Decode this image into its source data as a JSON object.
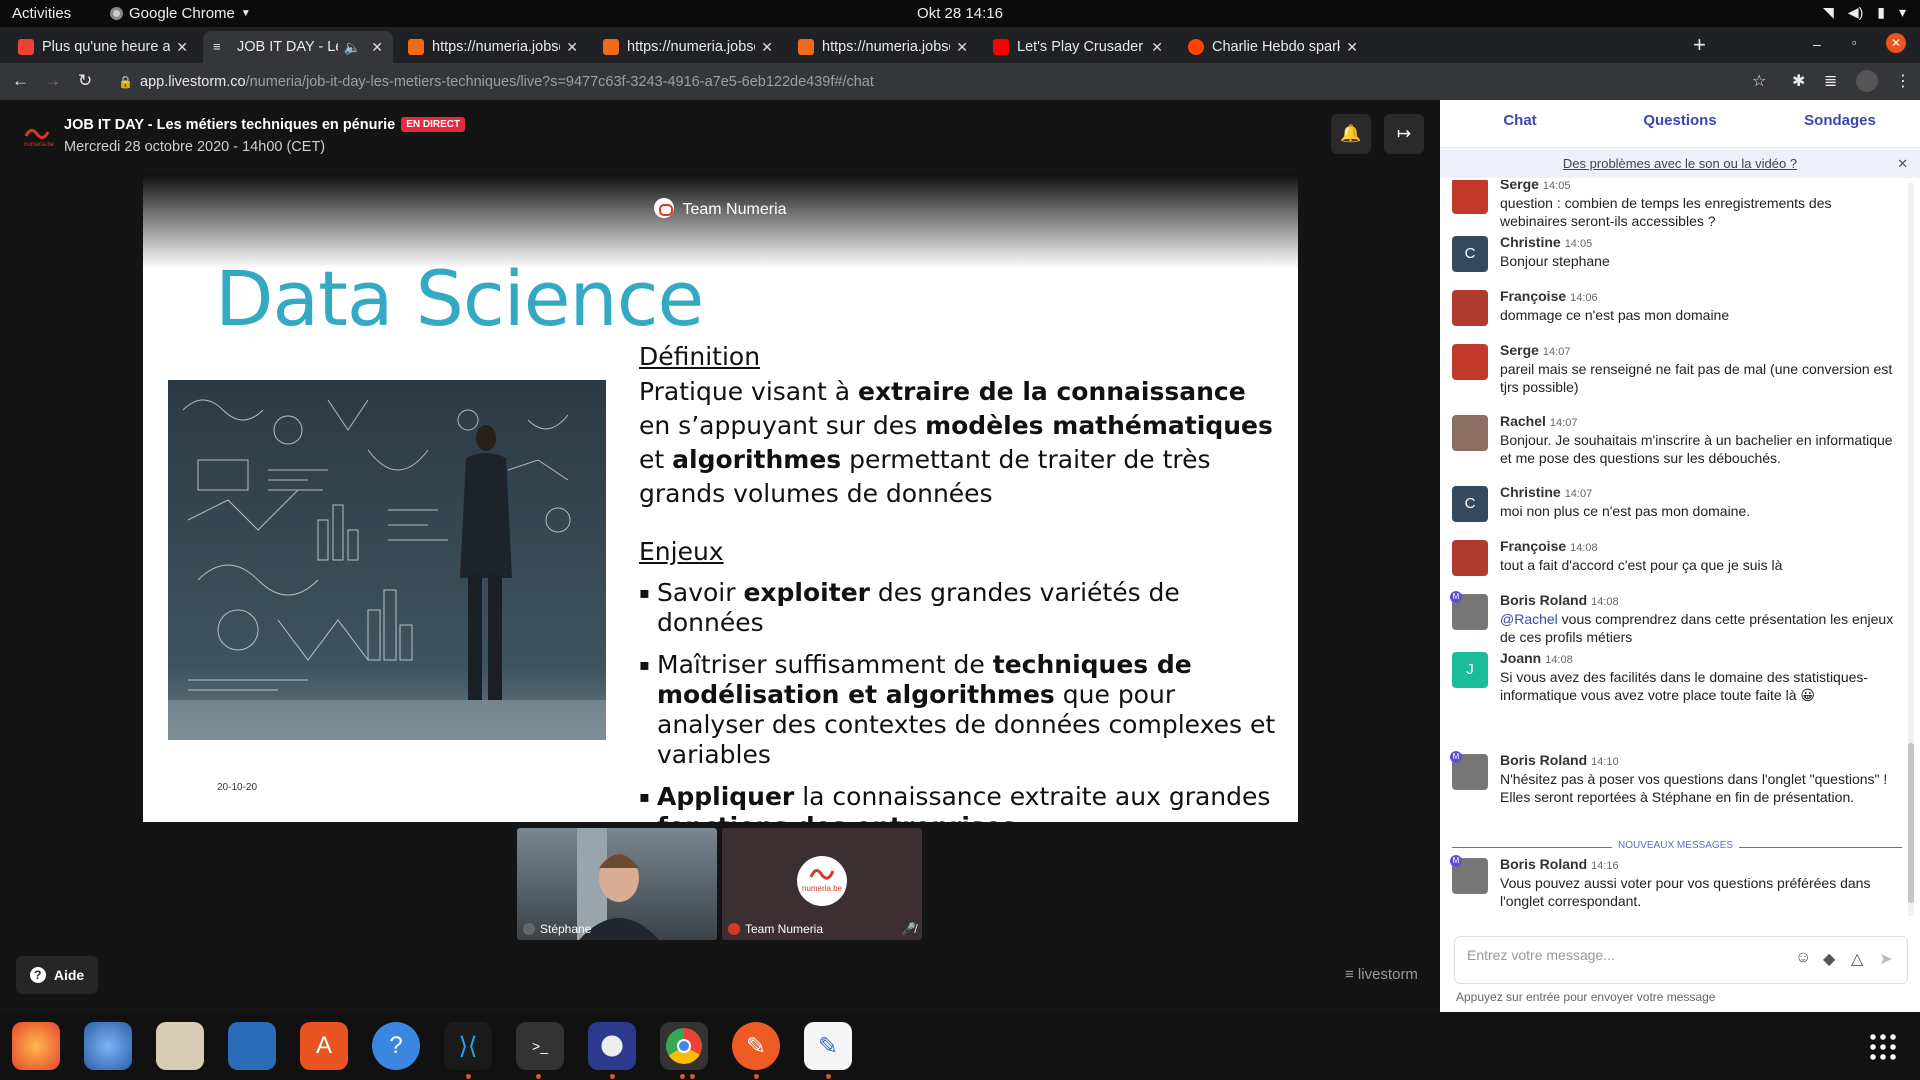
{
  "system": {
    "activities": "Activities",
    "app_name": "Google Chrome",
    "clock": "Okt 28  14:16"
  },
  "tabs": [
    {
      "title": "Plus qu'une heure avant",
      "favicon_color": "#ea4335"
    },
    {
      "title": "JOB IT DAY - Les métiers techniques",
      "favicon_color": "#9aa0a6"
    },
    {
      "title": "https://numeria.jobsdays.be",
      "favicon_color": "#f06a1d"
    },
    {
      "title": "https://numeria.jobsdays.be",
      "favicon_color": "#f06a1d"
    },
    {
      "title": "https://numeria.jobsdays.be",
      "favicon_color": "#f06a1d"
    },
    {
      "title": "Let's Play Crusader Kings",
      "favicon_color": "#ff0000"
    },
    {
      "title": "Charlie Hebdo sparks Turkish",
      "favicon_color": "#ff4500"
    }
  ],
  "address": {
    "host": "app.livestorm.co",
    "path": "/numeria/job-it-day-les-metiers-techniques/live?s=9477c63f-3243-4916-a7e5-6eb122de439f#/chat"
  },
  "event": {
    "title": "JOB IT DAY - Les métiers techniques en pénurie",
    "live_badge": "EN DIRECT",
    "date": "Mercredi 28 octobre 2020 - 14h00 (CET)"
  },
  "slide": {
    "presenter": "Team Numeria",
    "title": "Data Science",
    "def_heading": "Définition",
    "def_text": [
      "Pratique visant à ",
      "extraire de la connaissance",
      " en s’appuyant sur des ",
      "modèles mathématiques",
      " et ",
      "algorithmes",
      " permettant de traiter de très grands volumes de données"
    ],
    "issues_heading": "Enjeux",
    "bullets": [
      [
        "Savoir ",
        "exploiter",
        " des grandes variétés de données"
      ],
      [
        "Maîtriser suffisamment de ",
        "techniques de modélisation et algorithmes",
        " que pour analyser des contextes de données complexes et variables"
      ],
      [
        "",
        "Appliquer",
        " la connaissance extraite aux grandes ",
        "fonctions des entreprises"
      ]
    ],
    "date": "20-10-20"
  },
  "participants": [
    {
      "name": "Stéphane"
    },
    {
      "name": "Team Numeria",
      "logo": "numeria.be"
    }
  ],
  "help": "Aide",
  "brand": "livestorm",
  "chat": {
    "tabs": [
      "Chat",
      "Questions",
      "Sondages"
    ],
    "notice": "Des problèmes avec le son ou la vidéo ?",
    "new_messages": "NOUVEAUX MESSAGES",
    "messages": [
      {
        "author": "Serge",
        "time": "14:05",
        "text": "question : combien de temps les enregistrements des webinaires seront-ils accessibles ?",
        "avatar_color": "#c0392b"
      },
      {
        "author": "Christine",
        "time": "14:05",
        "text": "Bonjour stephane",
        "avatar_letter": "C",
        "avatar_color": "#34495e"
      },
      {
        "author": "Françoise",
        "time": "14:06",
        "text": "dommage ce n'est pas mon domaine",
        "avatar_color": "#b03a2e"
      },
      {
        "author": "Serge",
        "time": "14:07",
        "text": "pareil mais se renseigné ne fait pas de mal (une conversion est tjrs possible)",
        "avatar_color": "#c0392b"
      },
      {
        "author": "Rachel",
        "time": "14:07",
        "text": "Bonjour. Je souhaitais m'inscrire à un bachelier en informatique et me pose des questions sur les débouchés.",
        "avatar_color": "#8d6e63"
      },
      {
        "author": "Christine",
        "time": "14:07",
        "text": "moi non plus ce n'est pas mon domaine.",
        "avatar_letter": "C",
        "avatar_color": "#34495e"
      },
      {
        "author": "Françoise",
        "time": "14:08",
        "text": "tout a fait d'accord c'est pour ça que je suis là",
        "avatar_color": "#b03a2e"
      },
      {
        "author": "Boris Roland",
        "time": "14:08",
        "mention": "@Rachel",
        "text": " vous comprendrez dans cette présentation les enjeux de ces profils métiers",
        "avatar_color": "#777777",
        "badge": "M"
      },
      {
        "author": "Joann",
        "time": "14:08",
        "text": "Si vous avez des facilités dans le domaine des statistiques-informatique vous avez votre place toute faite là 😀",
        "avatar_letter": "J",
        "avatar_color": "#1abc9c"
      },
      {
        "author": "Boris Roland",
        "time": "14:10",
        "text": "N'hésitez pas à poser vos questions dans l'onglet \"questions\" ! Elles seront reportées à Stéphane en fin de présentation.",
        "avatar_color": "#777777",
        "badge": "M"
      },
      {
        "author": "Boris Roland",
        "time": "14:16",
        "text": "Vous pouvez aussi voter pour vos questions préférées dans l'onglet correspondant.",
        "avatar_color": "#777777",
        "badge": "M"
      }
    ],
    "input_placeholder": "Entrez votre message...",
    "hint": "Appuyez sur entrée pour envoyer votre message"
  }
}
